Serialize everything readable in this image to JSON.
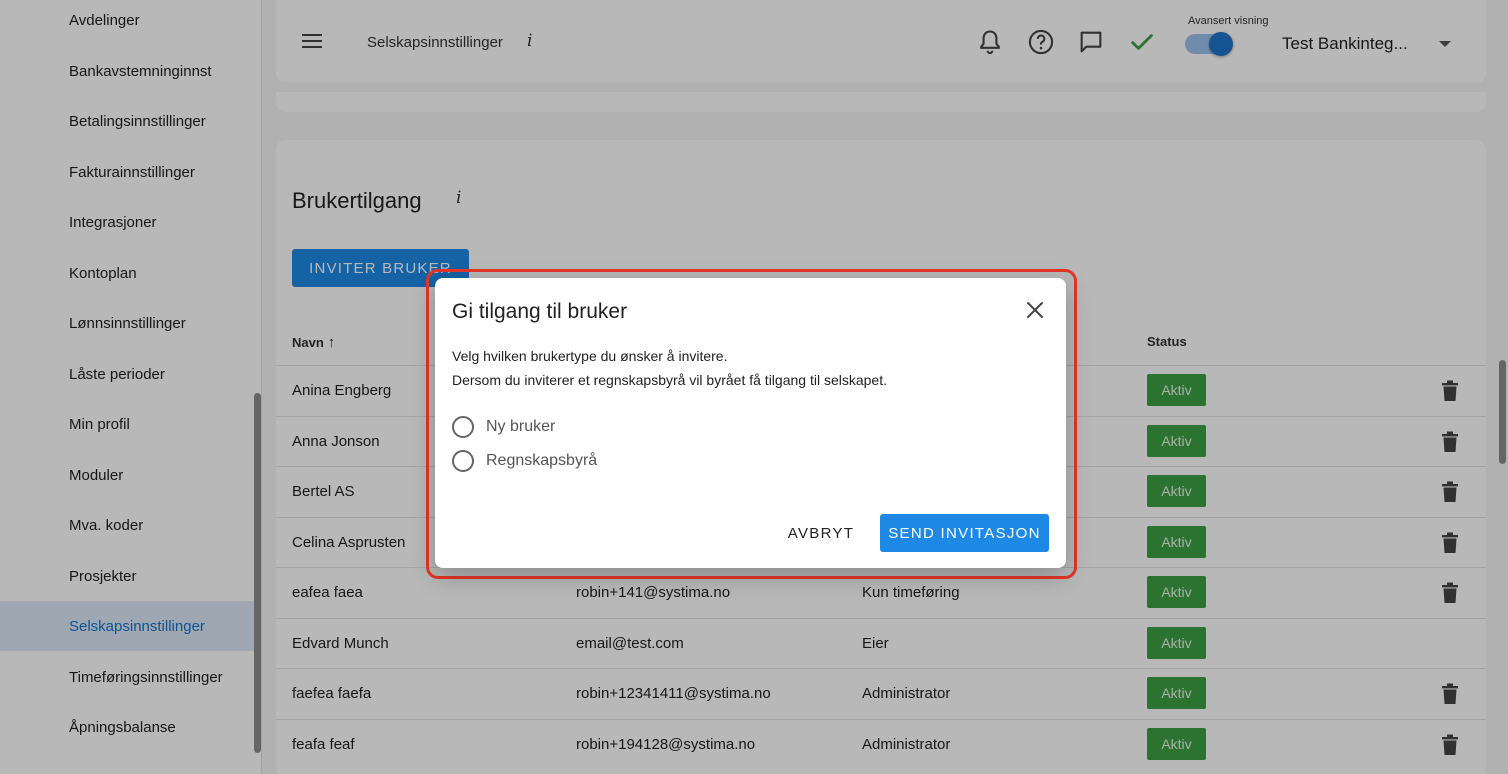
{
  "sidebar": {
    "items": [
      {
        "label": "Avdelinger"
      },
      {
        "label": "Bankavstemninginnst"
      },
      {
        "label": "Betalingsinnstillinger"
      },
      {
        "label": "Fakturainnstillinger"
      },
      {
        "label": "Integrasjoner"
      },
      {
        "label": "Kontoplan"
      },
      {
        "label": "Lønnsinnstillinger"
      },
      {
        "label": "Låste perioder"
      },
      {
        "label": "Min profil"
      },
      {
        "label": "Moduler"
      },
      {
        "label": "Mva. koder"
      },
      {
        "label": "Prosjekter"
      },
      {
        "label": "Selskapsinnstillinger",
        "active": true
      },
      {
        "label": "Timeføringsinnstillinger"
      },
      {
        "label": "Åpningsbalanse"
      }
    ]
  },
  "header": {
    "title": "Selskapsinnstillinger",
    "info": "i",
    "icons": [
      "menu-icon",
      "bell-icon",
      "help-icon",
      "chat-icon",
      "check-icon"
    ],
    "toggle_label": "Avansert visning",
    "toggle_on": true,
    "company": "Test Bankinteg...",
    "accent": "#1e74c9"
  },
  "main": {
    "title": "Brukertilgang",
    "info": "i",
    "invite_label": "INVITER BRUKER",
    "columns": {
      "name": "Navn",
      "status": "Status"
    },
    "rows": [
      {
        "name": "Anina Engberg",
        "email": "",
        "role": "",
        "status": "Aktiv",
        "deletable": true
      },
      {
        "name": "Anna Jonson",
        "email": "",
        "role": "",
        "status": "Aktiv",
        "deletable": true
      },
      {
        "name": "Bertel AS",
        "email": "",
        "role": "",
        "status": "Aktiv",
        "deletable": true
      },
      {
        "name": "Celina Asprusten",
        "email": "",
        "role": "",
        "status": "Aktiv",
        "deletable": true
      },
      {
        "name": "eafea faea",
        "email": "robin+141@systima.no",
        "role": "Kun timeføring",
        "status": "Aktiv",
        "deletable": true
      },
      {
        "name": "Edvard Munch",
        "email": "email@test.com",
        "role": "Eier",
        "status": "Aktiv",
        "deletable": false
      },
      {
        "name": "faefea faefa",
        "email": "robin+12341411@systima.no",
        "role": "Administrator",
        "status": "Aktiv",
        "deletable": true
      },
      {
        "name": "feafa feaf",
        "email": "robin+194128@systima.no",
        "role": "Administrator",
        "status": "Aktiv",
        "deletable": true
      }
    ],
    "status_color": "#3e9e44"
  },
  "dialog": {
    "title": "Gi tilgang til bruker",
    "line1": "Velg hvilken brukertype du ønsker å invitere.",
    "line2": "Dersom du inviterer et regnskapsbyrå vil byrået få tilgang til selskapet.",
    "options": [
      {
        "label": "Ny bruker",
        "selected": false
      },
      {
        "label": "Regnskapsbyrå",
        "selected": false
      }
    ],
    "cancel_label": "AVBRYT",
    "send_label": "SEND INVITASJON",
    "highlight_color": "#e53527"
  }
}
